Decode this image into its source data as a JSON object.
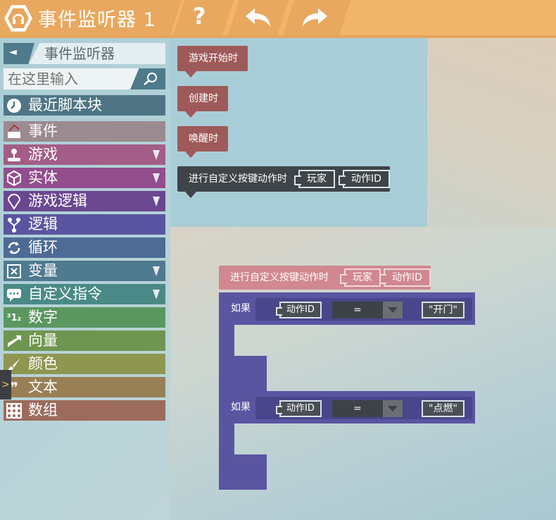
{
  "header": {
    "title": "事件监听器 1",
    "help_label": "?",
    "undo_icon": "undo-arrow-icon",
    "redo_icon": "redo-arrow-icon"
  },
  "sidebar": {
    "back_label": "事件监听器",
    "back_arrow": "◄",
    "search_placeholder": "在这里输入",
    "recent": "最近脚本块",
    "categories": [
      {
        "label": "事件",
        "color": "#9c8a91",
        "icon": "event-icon",
        "expandable": false
      },
      {
        "label": "游戏",
        "color": "#a35d86",
        "icon": "joystick-icon",
        "expandable": true
      },
      {
        "label": "实体",
        "color": "#924e8c",
        "icon": "cube-icon",
        "expandable": true
      },
      {
        "label": "游戏逻辑",
        "color": "#6b4790",
        "icon": "logic-pin-icon",
        "expandable": true
      },
      {
        "label": "逻辑",
        "color": "#5a55a0",
        "icon": "branch-icon",
        "expandable": false
      },
      {
        "label": "循环",
        "color": "#4e6b96",
        "icon": "loop-icon",
        "expandable": false
      },
      {
        "label": "变量",
        "color": "#4f7a8f",
        "icon": "variable-icon",
        "expandable": true
      },
      {
        "label": "自定义指令",
        "color": "#4a8a86",
        "icon": "chat-icon",
        "expandable": true
      },
      {
        "label": "数字",
        "color": "#5a9760",
        "icon": "number-icon",
        "expandable": false
      },
      {
        "label": "向量",
        "color": "#6f9650",
        "icon": "vector-icon",
        "expandable": false
      },
      {
        "label": "颜色",
        "color": "#8f9650",
        "icon": "brush-icon",
        "expandable": false
      },
      {
        "label": "文本",
        "color": "#997f55",
        "icon": "quote-icon",
        "expandable": false
      },
      {
        "label": "数组",
        "color": "#9c6b5c",
        "icon": "grid-icon",
        "expandable": false
      }
    ],
    "colors": {
      "recent": "#4f7585",
      "panel_button": "#4e7a8c"
    }
  },
  "flyout": {
    "blocks": [
      {
        "label": "游戏开始时"
      },
      {
        "label": "创建时"
      },
      {
        "label": "唤醒时"
      }
    ],
    "key_event": {
      "label": "进行自定义按键动作时",
      "slot1": "玩家",
      "slot2": "动作ID"
    }
  },
  "workspace": {
    "event": {
      "label": "进行自定义按键动作时",
      "slot1": "玩家",
      "slot2": "动作ID"
    },
    "if_blocks": [
      {
        "label": "如果",
        "var": "动作ID",
        "op": "=",
        "value": "\"开门\""
      },
      {
        "label": "如果",
        "var": "动作ID",
        "op": "=",
        "value": "\"点燃\""
      }
    ]
  },
  "handle_label": ">"
}
